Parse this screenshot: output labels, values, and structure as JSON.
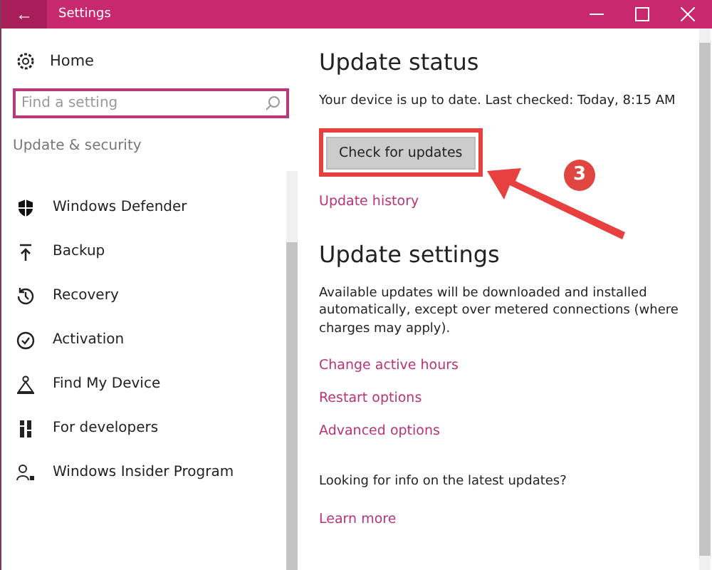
{
  "window": {
    "title": "Settings",
    "back_button": "←"
  },
  "sidebar": {
    "home": "Home",
    "search": {
      "placeholder": "Find a setting"
    },
    "section": "Update & security",
    "items": [
      {
        "label": "Windows Defender"
      },
      {
        "label": "Backup"
      },
      {
        "label": "Recovery"
      },
      {
        "label": "Activation"
      },
      {
        "label": "Find My Device"
      },
      {
        "label": "For developers"
      },
      {
        "label": "Windows Insider Program"
      }
    ]
  },
  "content": {
    "status_heading": "Update status",
    "status_text": "Your device is up to date. Last checked: Today, 8:15 AM",
    "check_button": "Check for updates",
    "history_link": "Update history",
    "settings_heading": "Update settings",
    "settings_text": "Available updates will be downloaded and installed automatically, except over metered connections (where charges may apply).",
    "links": [
      "Change active hours",
      "Restart options",
      "Advanced options"
    ],
    "info_text": "Looking for info on the latest updates?",
    "learn_link": "Learn more"
  },
  "annotation": {
    "step": "3"
  }
}
